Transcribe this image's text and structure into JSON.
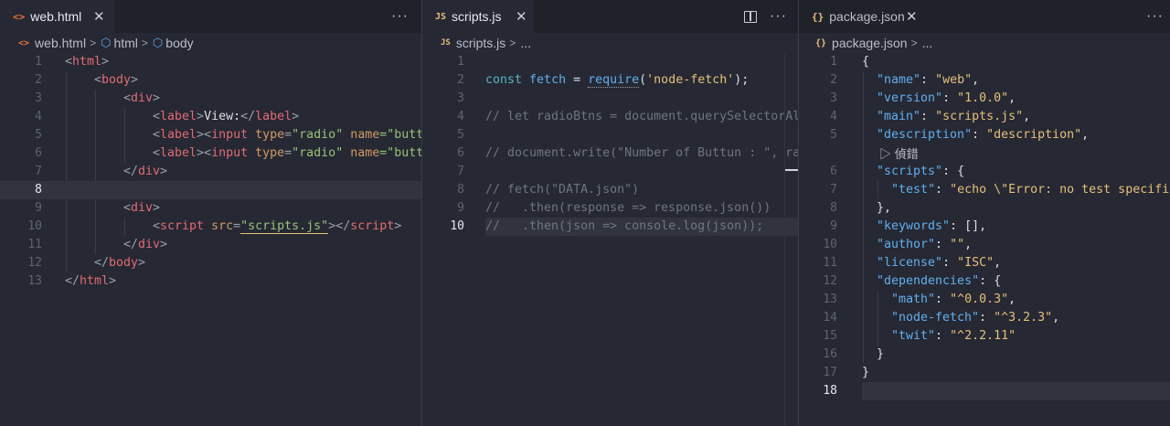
{
  "panes": {
    "html": {
      "tab": {
        "icon": "<>",
        "label": "web.html",
        "close": "✕",
        "more": "···"
      },
      "breadcrumb": {
        "file": "web.html",
        "items": [
          "html",
          "body"
        ],
        "sep": ">"
      },
      "lines": [
        "1",
        "2",
        "3",
        "4",
        "5",
        "6",
        "7",
        "8",
        "9",
        "10",
        "11",
        "12",
        "13"
      ],
      "code": {
        "l1_open": "<",
        "l1_tag": "html",
        "l1_close": ">",
        "l2_tag": "body",
        "l3_tag": "div",
        "l4_tag": "label",
        "l4_text": "View:",
        "l4_end": "</",
        "l5_label": "label",
        "l5_input": "input",
        "l5_type": "type",
        "l5_eq": "=",
        "l5_val": "\"radio\"",
        "l5_name": "name",
        "l5_rest": "=\"butt",
        "l6_label": "label",
        "l6_input": "input",
        "l6_type": "type",
        "l6_val": "\"radio\"",
        "l6_name": "name",
        "l6_rest": "=\"butt",
        "l7_tag": "div",
        "l9_tag": "div",
        "l10_tag": "script",
        "l10_attr": "src",
        "l10_val": "\"scripts.js\"",
        "l10_end": "script",
        "l11_tag": "div",
        "l12_tag": "body",
        "l13_tag": "html"
      }
    },
    "js": {
      "tab": {
        "icon": "JS",
        "label": "scripts.js",
        "close": "✕",
        "more": "···"
      },
      "breadcrumb": {
        "file": "scripts.js",
        "ellipsis": "...",
        "sep": ">"
      },
      "lines": [
        "1",
        "2",
        "3",
        "4",
        "5",
        "6",
        "7",
        "8",
        "9",
        "10"
      ],
      "code": {
        "l2_const": "const",
        "l2_var": "fetch",
        "l2_eq": " = ",
        "l2_fn": "require",
        "l2_arg": "'node-fetch'",
        "l2_end": ");",
        "l4": "// let radioBtns = document.querySelectorAl",
        "l6": "// document.write(\"Number of Buttun : \", ra",
        "l8": "// fetch(\"DATA.json\")",
        "l9": "//   .then(response => response.json())",
        "l10": "//   .then(json => console.log(json));"
      }
    },
    "json": {
      "tab": {
        "icon": "{}",
        "label": "package.json",
        "close": "✕",
        "more": "···"
      },
      "breadcrumb": {
        "file": "package.json",
        "ellipsis": "...",
        "sep": ">"
      },
      "lines": [
        "1",
        "2",
        "3",
        "4",
        "5",
        "6",
        "7",
        "8",
        "9",
        "10",
        "11",
        "12",
        "13",
        "14",
        "15",
        "16",
        "17",
        "18"
      ],
      "fold_label": "▷ 偵錯",
      "code": {
        "l1": "{",
        "name_k": "\"name\"",
        "name_v": "\"web\"",
        "version_k": "\"version\"",
        "version_v": "\"1.0.0\"",
        "main_k": "\"main\"",
        "main_v": "\"scripts.js\"",
        "desc_k": "\"description\"",
        "desc_v": "\"description\"",
        "scripts_k": "\"scripts\"",
        "test_k": "\"test\"",
        "test_v": "\"echo \\\"Error: no test specifi",
        "close_brace_comma": "},",
        "keywords_k": "\"keywords\"",
        "keywords_v": "[],",
        "author_k": "\"author\"",
        "author_v": "\"\"",
        "license_k": "\"license\"",
        "license_v": "\"ISC\"",
        "deps_k": "\"dependencies\"",
        "math_k": "\"math\"",
        "math_v": "\"^0.0.3\"",
        "nf_k": "\"node-fetch\"",
        "nf_v": "\"^3.2.3\"",
        "twit_k": "\"twit\"",
        "twit_v": "\"^2.2.11\"",
        "inner_close": "}",
        "outer_close": "}"
      }
    }
  }
}
